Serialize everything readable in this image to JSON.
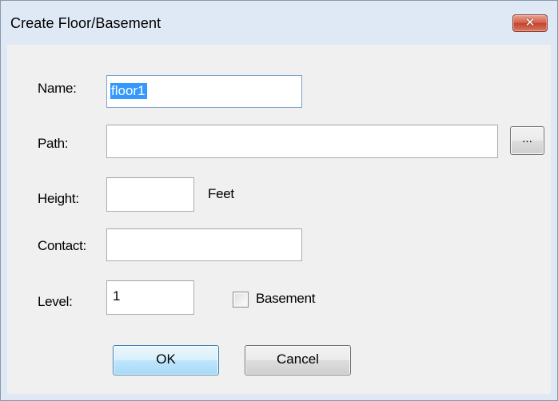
{
  "dialog": {
    "title": "Create Floor/Basement",
    "close_glyph": "✕"
  },
  "form": {
    "name_label": "Name:",
    "name_value": "floor1",
    "path_label": "Path:",
    "path_value": "",
    "browse_label": "...",
    "height_label": "Height:",
    "height_value": "",
    "height_unit": "Feet",
    "contact_label": "Contact:",
    "contact_value": "",
    "level_label": "Level:",
    "level_value": "1",
    "basement_label": "Basement",
    "basement_checked": false
  },
  "buttons": {
    "ok_label": "OK",
    "cancel_label": "Cancel"
  },
  "icons": {
    "close": "close-icon"
  },
  "colors": {
    "title_bar": "#dfe9f5",
    "close_button": "#c4432e",
    "selection": "#3399ff",
    "default_button_border": "#3c7fb1"
  }
}
